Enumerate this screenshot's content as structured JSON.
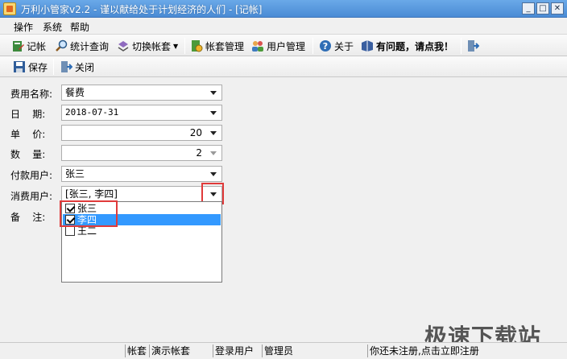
{
  "window": {
    "title": "万利小管家v2.2 - 谨以献给处于计划经济的人们 - [记帐]",
    "minimize_glyph": "_",
    "maximize_glyph": "□",
    "close_glyph": "✕"
  },
  "menu": [
    "操作",
    "系统",
    "帮助"
  ],
  "toolbar": {
    "record": "记帐",
    "stats": "统计查询",
    "switch_account": "切换帐套",
    "account_manage": "帐套管理",
    "user_manage": "用户管理",
    "about": "关于",
    "help": "有问题，请点我！"
  },
  "toolbar2": {
    "save": "保存",
    "close": "关闭"
  },
  "form": {
    "expense_name": {
      "label": "费用名称:",
      "value": "餐费"
    },
    "date": {
      "label": "日    期:",
      "value": "2018-07-31"
    },
    "unit_price": {
      "label": "单    价:",
      "value": "20"
    },
    "quantity": {
      "label": "数    量:",
      "value": "2"
    },
    "payer": {
      "label": "付款用户:",
      "value": "张三"
    },
    "consumers": {
      "label": "消费用户:",
      "value": "[张三, 李四]"
    },
    "remark": {
      "label": "备    注:"
    }
  },
  "consumer_options": [
    {
      "label": "张三",
      "checked": true,
      "selected": false
    },
    {
      "label": "李四",
      "checked": true,
      "selected": true
    },
    {
      "label": "王二",
      "checked": false,
      "selected": false
    }
  ],
  "status": {
    "account_label": "帐套",
    "account_value": "演示帐套",
    "user_label": "登录用户",
    "user_value": "管理员",
    "register": "你还未注册,点击立即注册"
  },
  "watermark": "极速下载站"
}
